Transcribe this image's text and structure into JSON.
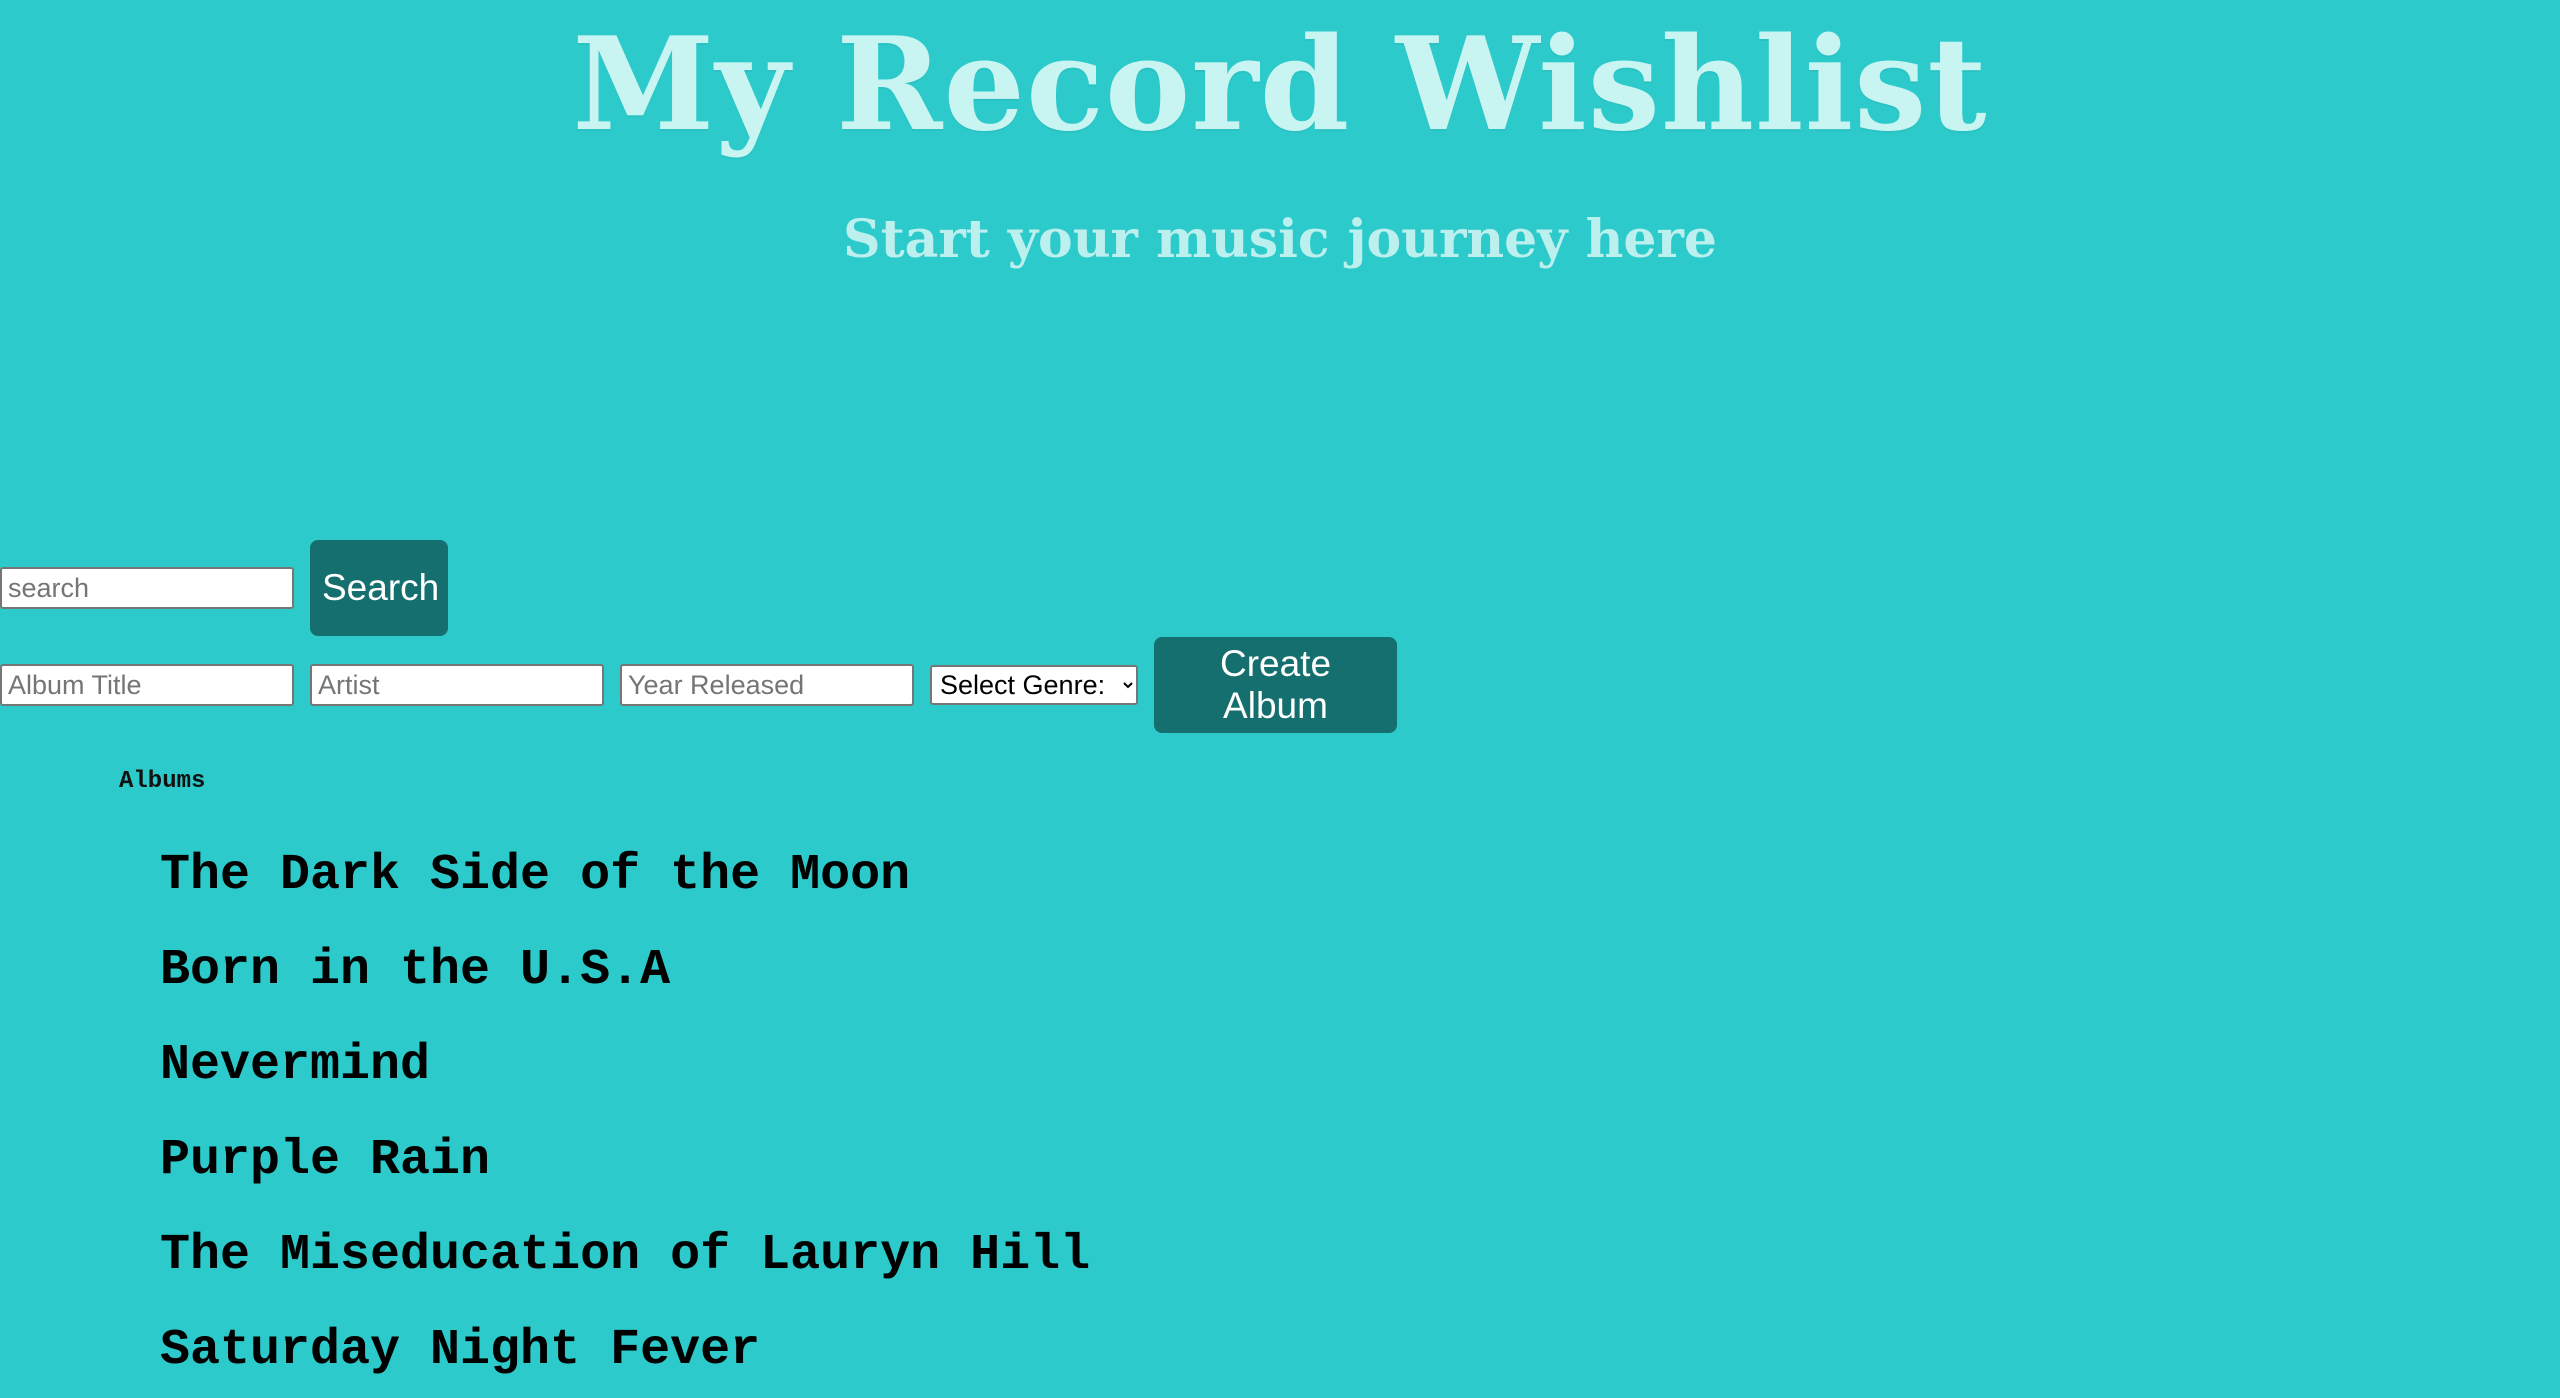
{
  "header": {
    "title": "My Record Wishlist",
    "subtitle": "Start your music journey here"
  },
  "search": {
    "placeholder": "search",
    "button_label": "Search"
  },
  "create_form": {
    "album_title_placeholder": "Album Title",
    "artist_placeholder": "Artist",
    "year_placeholder": "Year Released",
    "genre_selected": "Select Genre:",
    "button_label": "Create Album"
  },
  "albums": {
    "heading": "Albums",
    "items": [
      "The Dark Side of the Moon",
      "Born in the U.S.A",
      "Nevermind",
      "Purple Rain",
      "The Miseducation of Lauryn Hill",
      "Saturday Night Fever"
    ]
  },
  "colors": {
    "background": "#2ccaca",
    "button": "#166f6f",
    "title": "#c8f4f2"
  }
}
